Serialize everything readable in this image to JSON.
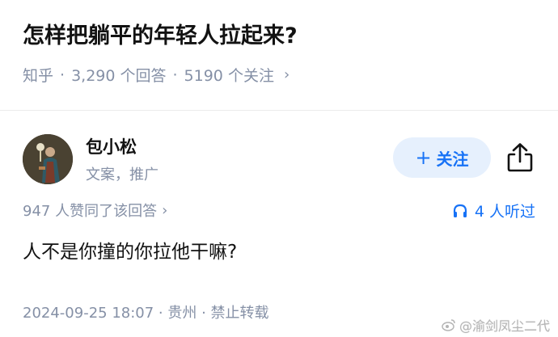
{
  "question": {
    "title": "怎样把躺平的年轻人拉起来?",
    "source": "知乎",
    "answers_count": "3,290 个回答",
    "followers_count": "5190 个关注",
    "separator": "·",
    "chevron": "›"
  },
  "author": {
    "name": "包小松",
    "bio": "文案，推广",
    "follow_plus": "+",
    "follow_label": "关注"
  },
  "answer": {
    "votes_text": "947 人赞同了该回答",
    "votes_chevron": "›",
    "listened_text": "4 人听过",
    "body": "人不是你撞的你拉他干嘛?",
    "footer": "2024-09-25 18:07 · 贵州 · 禁止转载"
  },
  "watermark": {
    "text": "@渝剑凤尘二代"
  },
  "colors": {
    "accent": "#1772f6",
    "follow_bg": "#e6f0fd",
    "meta_gray": "#8590a6",
    "text": "#121212"
  },
  "icons": {
    "share": "share-icon",
    "headphones": "headphones-icon",
    "weibo": "weibo-icon"
  }
}
